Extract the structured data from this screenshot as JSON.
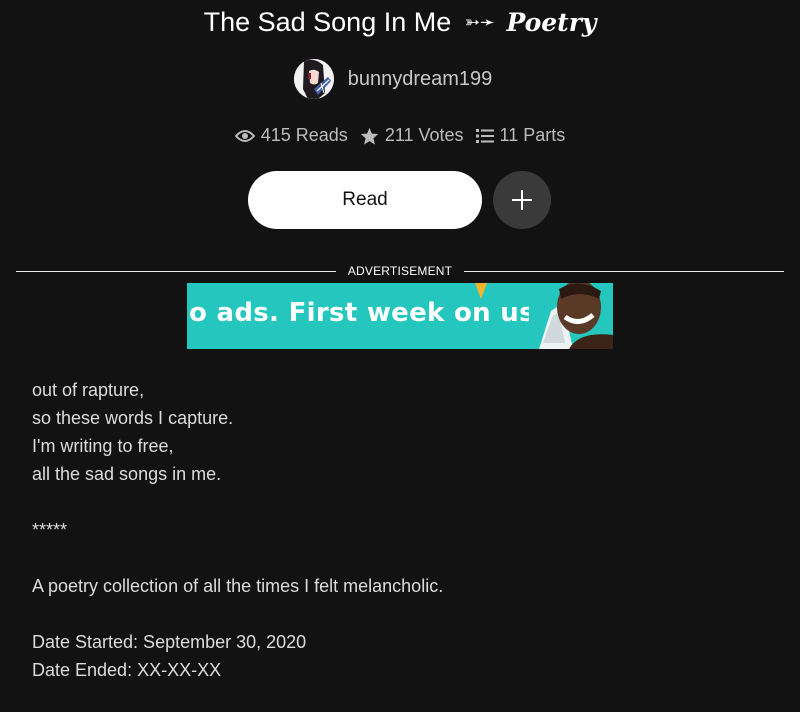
{
  "story": {
    "title": "The Sad Song In Me",
    "title_arrow": "➳➛",
    "genre": "Poetry"
  },
  "author": {
    "name": "bunnydream199",
    "avatar_icon": "anime-avatar"
  },
  "stats": {
    "reads": "415 Reads",
    "votes": "211 Votes",
    "parts": "11 Parts"
  },
  "actions": {
    "read_label": "Read",
    "add_icon": "plus-icon"
  },
  "ad": {
    "label": "ADVERTISEMENT",
    "banner_text": "o ads. First week on us.",
    "banner_color": "#24c6be"
  },
  "description": {
    "stanza": [
      "out of rapture,",
      "so these words I capture.",
      "I'm writing to free,",
      "all the sad songs in me."
    ],
    "separator": "*****",
    "summary": "A poetry collection of all the times I felt melancholic.",
    "date_started": "Date Started: September 30, 2020",
    "date_ended": "Date Ended: XX-XX-XX"
  },
  "colors": {
    "background": "#121212",
    "button_primary": "#ffffff",
    "button_secondary": "#3a3a3a"
  }
}
